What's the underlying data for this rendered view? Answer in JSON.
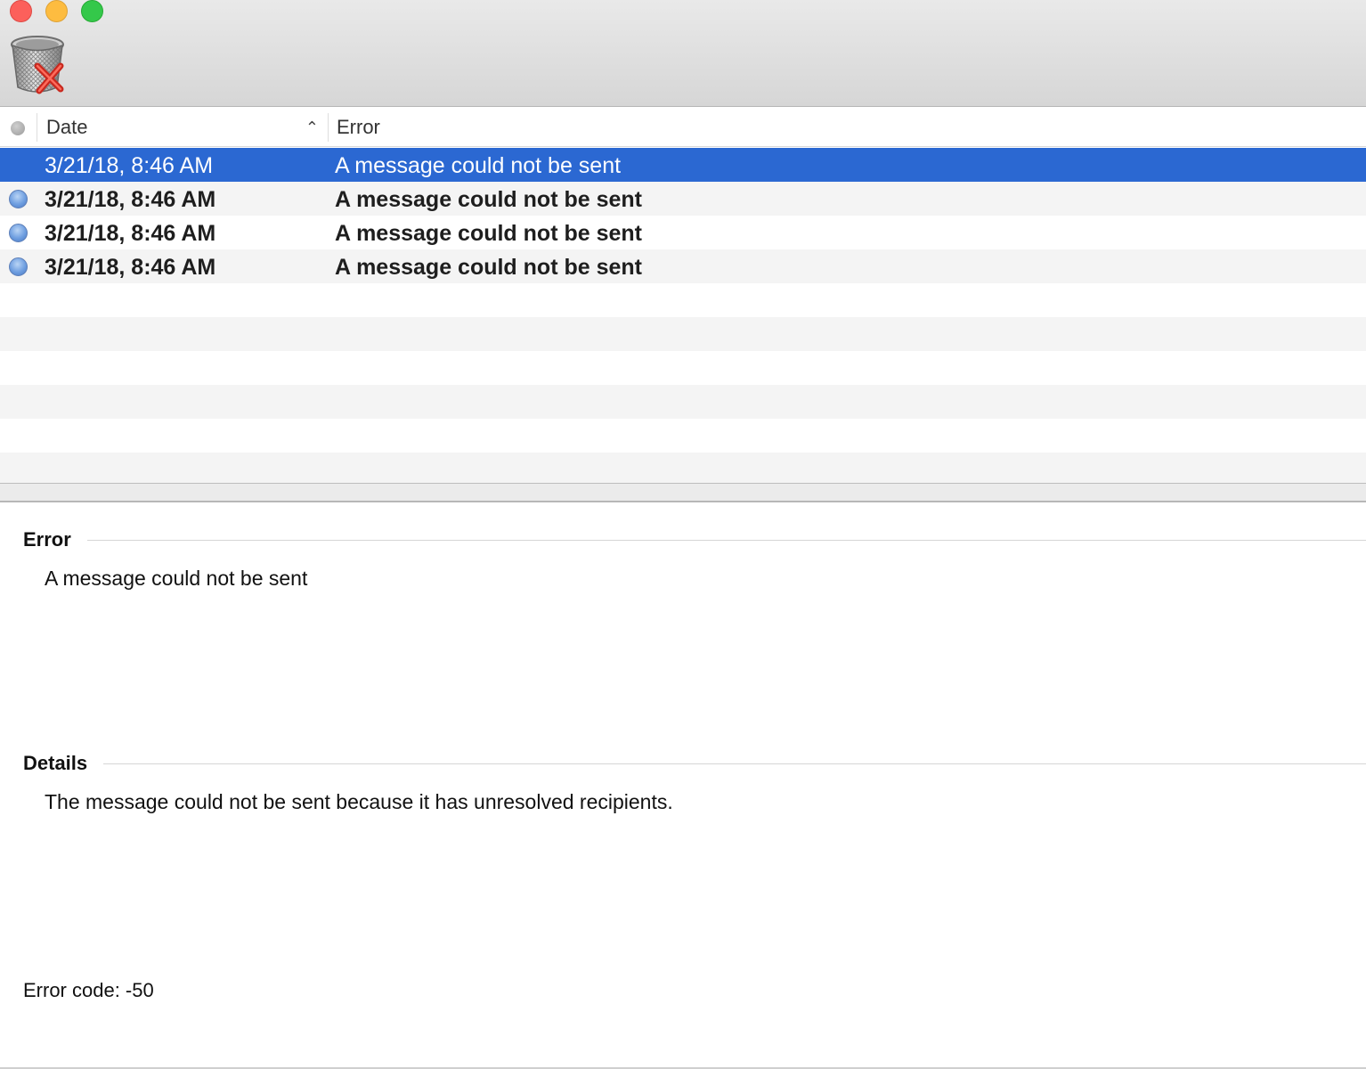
{
  "window": {
    "traffic_lights": [
      "close",
      "minimize",
      "zoom"
    ]
  },
  "toolbar": {
    "delete_icon": "trash-with-red-x-icon"
  },
  "table": {
    "columns": [
      {
        "key": "status",
        "label": ""
      },
      {
        "key": "date",
        "label": "Date",
        "sort": "ascending"
      },
      {
        "key": "error",
        "label": "Error"
      }
    ],
    "rows": [
      {
        "date": "3/21/18, 8:46 AM",
        "error": "A message could not be sent",
        "selected": true,
        "unread": false
      },
      {
        "date": "3/21/18, 8:46 AM",
        "error": "A message could not be sent",
        "selected": false,
        "unread": true
      },
      {
        "date": "3/21/18, 8:46 AM",
        "error": "A message could not be sent",
        "selected": false,
        "unread": true
      },
      {
        "date": "3/21/18, 8:46 AM",
        "error": "A message could not be sent",
        "selected": false,
        "unread": true
      }
    ]
  },
  "detail": {
    "error_title": "Error",
    "error_text": "A message could not be sent",
    "details_title": "Details",
    "details_text": "The message could not be sent because it has unresolved recipients.",
    "error_code": "Error code: -50"
  },
  "colors": {
    "selection": "#2b68d2",
    "alt_row": "#f4f4f4",
    "unread_dot": "#6e9ee0"
  }
}
